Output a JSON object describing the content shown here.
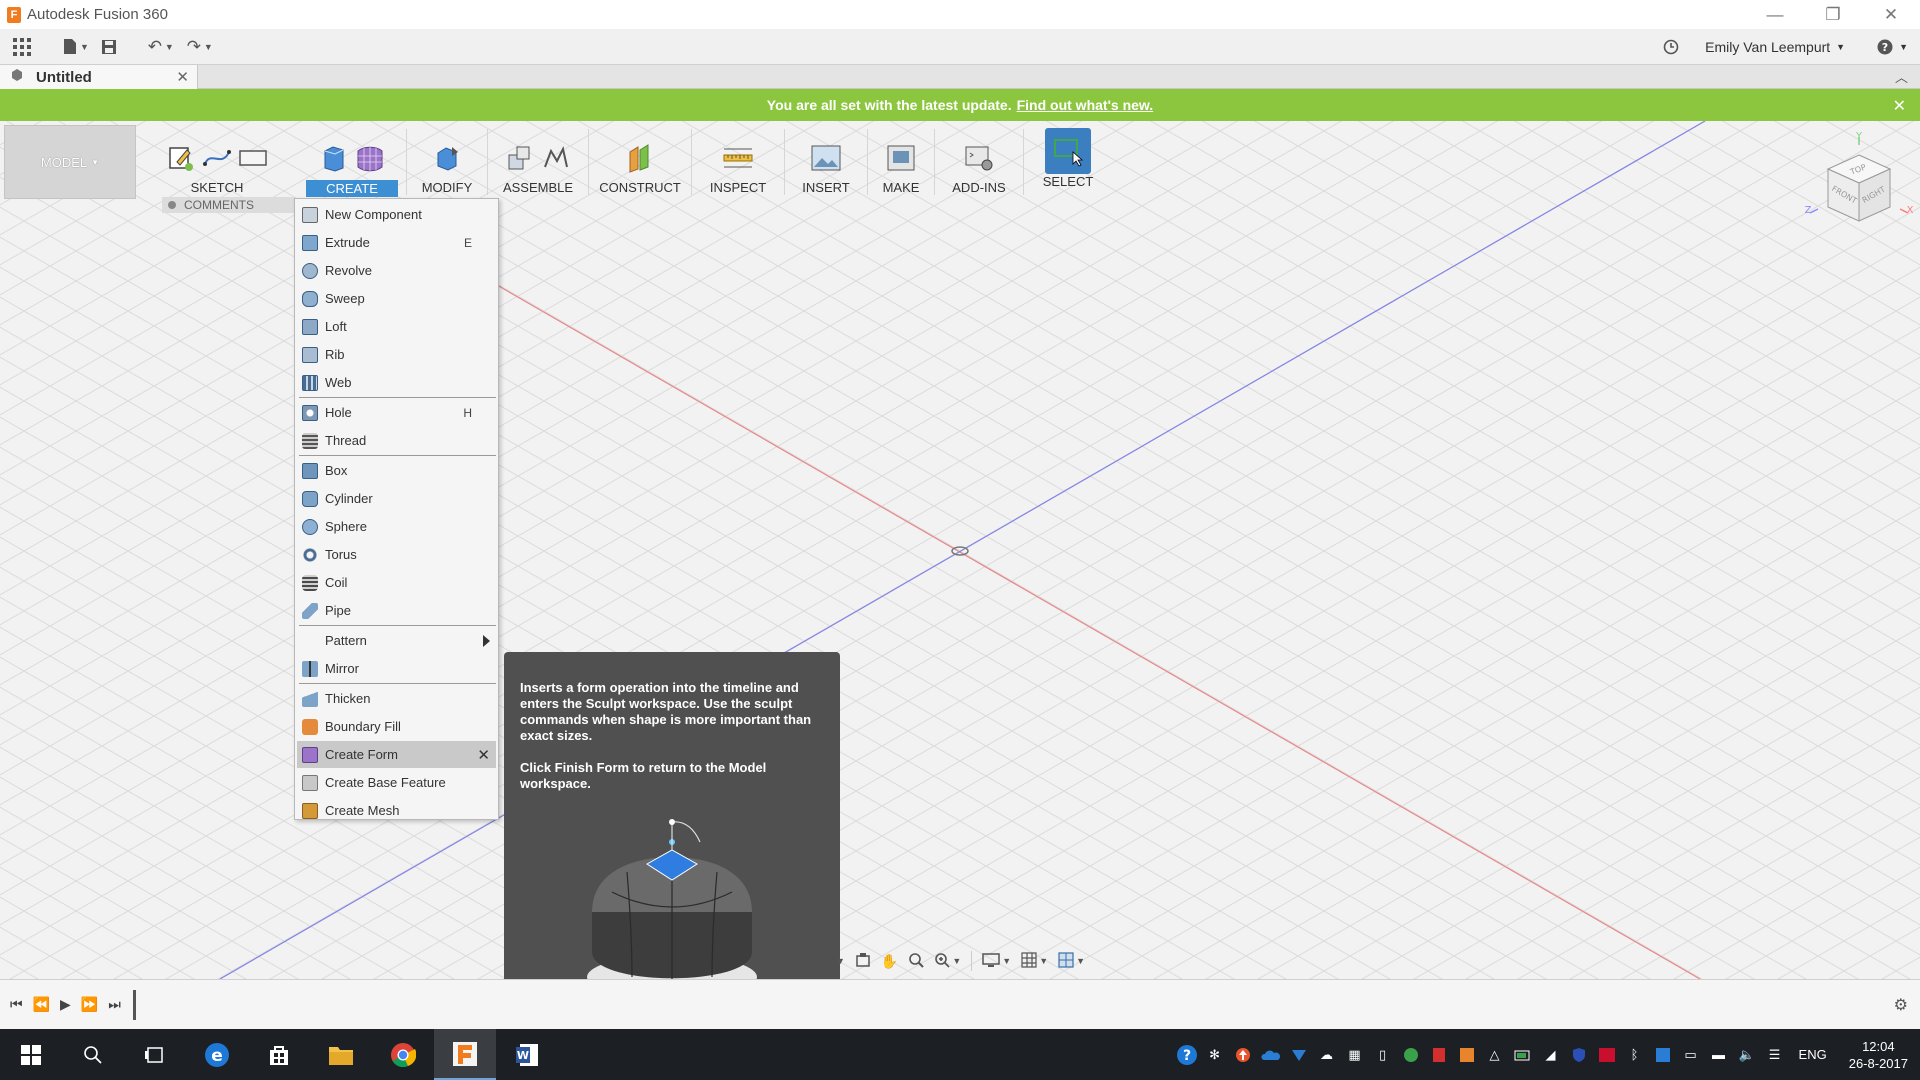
{
  "window": {
    "title": "Autodesk Fusion 360",
    "controls": [
      "—",
      "❐",
      "✕"
    ]
  },
  "user": {
    "name": "Emily Van Leempurt"
  },
  "tab": {
    "name": "Untitled"
  },
  "banner": {
    "text": "You are all set with the latest update.",
    "link": "Find out what's new."
  },
  "workspace": {
    "label": "MODEL"
  },
  "toolbar": {
    "groups": [
      "SKETCH",
      "CREATE",
      "MODIFY",
      "ASSEMBLE",
      "CONSTRUCT",
      "INSPECT",
      "INSERT",
      "MAKE",
      "ADD-INS",
      "SELECT"
    ],
    "active": "CREATE"
  },
  "browser": {
    "comments": "COMMENTS"
  },
  "create_menu": {
    "items": [
      {
        "label": "New Component",
        "key": ""
      },
      {
        "label": "Extrude",
        "key": "E"
      },
      {
        "label": "Revolve",
        "key": ""
      },
      {
        "label": "Sweep",
        "key": ""
      },
      {
        "label": "Loft",
        "key": ""
      },
      {
        "label": "Rib",
        "key": ""
      },
      {
        "label": "Web",
        "key": ""
      },
      {
        "label": "Hole",
        "key": "H"
      },
      {
        "label": "Thread",
        "key": ""
      },
      {
        "label": "Box",
        "key": ""
      },
      {
        "label": "Cylinder",
        "key": ""
      },
      {
        "label": "Sphere",
        "key": ""
      },
      {
        "label": "Torus",
        "key": ""
      },
      {
        "label": "Coil",
        "key": ""
      },
      {
        "label": "Pipe",
        "key": ""
      },
      {
        "label": "Pattern",
        "key": ""
      },
      {
        "label": "Mirror",
        "key": ""
      },
      {
        "label": "Thicken",
        "key": ""
      },
      {
        "label": "Boundary Fill",
        "key": ""
      },
      {
        "label": "Create Form",
        "key": ""
      },
      {
        "label": "Create Base Feature",
        "key": ""
      },
      {
        "label": "Create Mesh",
        "key": ""
      }
    ],
    "highlighted": "Create Form"
  },
  "tooltip": {
    "p1": "Inserts a form operation into the timeline and enters the Sculpt workspace. Use the sculpt commands when shape is more important than exact sizes.",
    "p2": "Click Finish Form to return to the Model workspace."
  },
  "viewcube": {
    "top": "TOP",
    "front": "FRONT",
    "right": "RIGHT",
    "axis_x": "X",
    "axis_y": "Y",
    "axis_z": "Z"
  },
  "taskbar": {
    "lang": "ENG",
    "time": "12:04",
    "date": "26-8-2017"
  },
  "colors": {
    "banner": "#8cc63f",
    "active_tab": "#3c8fd3",
    "x_axis": "#e06666",
    "z_axis": "#6a6ae8",
    "tooltip_bg": "#505050"
  }
}
